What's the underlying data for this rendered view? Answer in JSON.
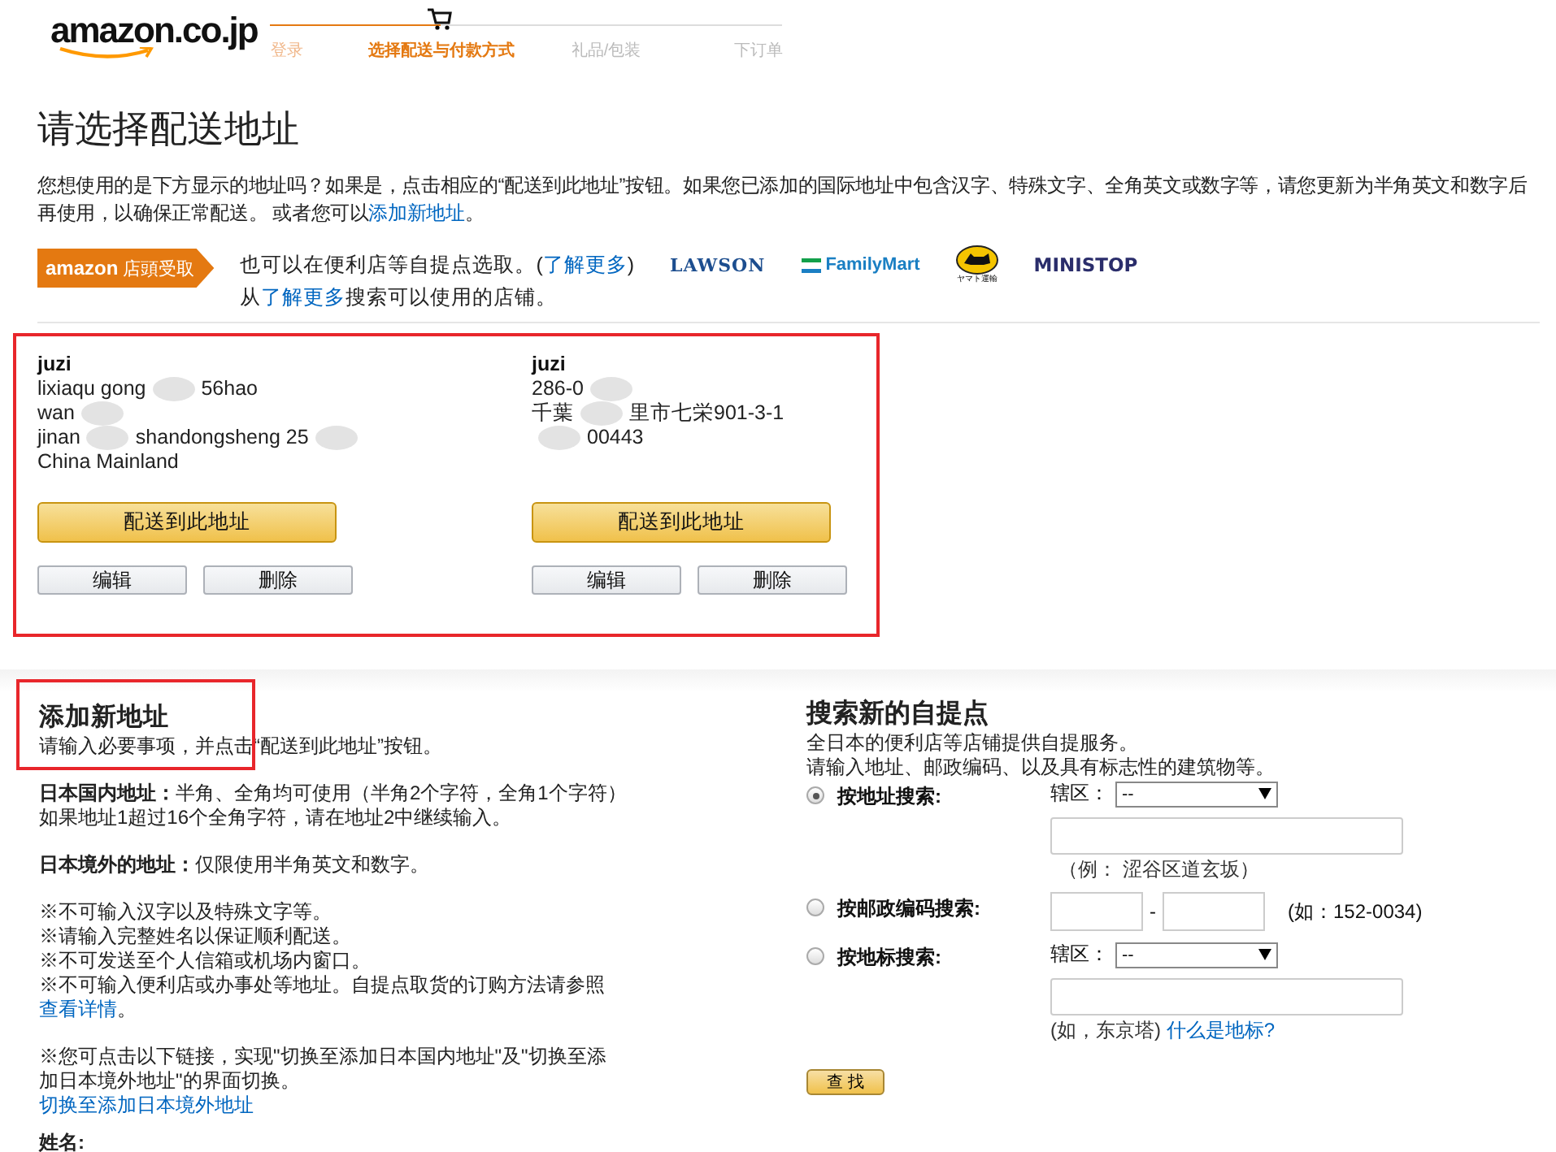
{
  "header": {
    "logo": "amazon.co.jp",
    "steps": [
      {
        "label": "登录",
        "completed": true,
        "selected": false
      },
      {
        "label": "选择配送与付款方式",
        "completed": false,
        "selected": true
      },
      {
        "label": "礼品/包装",
        "completed": false,
        "selected": false
      },
      {
        "label": "下订单",
        "completed": false,
        "selected": false
      }
    ]
  },
  "page_title": "请选择配送地址",
  "intro": {
    "text": "您想使用的是下方显示的地址吗？如果是，点击相应的“配送到此地址”按钮。如果您已添加的国际地址中包含汉字、特殊文字、全角英文或数字等，请您更新为半角英文和数字后再使用，以确保正常配送。 或者您可以",
    "link": "添加新地址",
    "end": "。"
  },
  "pickup": {
    "badge_brand": "amazon",
    "badge_label": "店頭受取",
    "line1": "也可以在便利店等自提点选取。(",
    "line1_link": "了解更多",
    "line1_end": ")",
    "line2_start": "从",
    "line2_link": "了解更多",
    "line2_end": "搜索可以使用的店铺。",
    "brands": [
      {
        "kind": "lawson",
        "name": "LAWSON"
      },
      {
        "kind": "familymart",
        "name": "FamilyMart"
      },
      {
        "kind": "yamato",
        "name": "ヤマト運輸"
      },
      {
        "kind": "ministop",
        "name": "MINISTOP"
      }
    ]
  },
  "addresses": {
    "highlighted": true,
    "cards": [
      {
        "name": "juzi",
        "lines": [
          {
            "blur_start": false,
            "parts": [
              "lixiaqu gong",
              "56hao"
            ],
            "blur_end": false
          },
          {
            "blur_start": false,
            "parts": [
              "wan"
            ],
            "blur_end": true
          },
          {
            "blur_start": false,
            "parts": [
              "jinan",
              "shandongsheng 25"
            ],
            "blur_end": true
          },
          {
            "blur_start": false,
            "parts": [
              "China Mainland"
            ],
            "blur_end": false
          }
        ],
        "ship_button": "配送到此地址",
        "edit_button": "编辑",
        "delete_button": "删除"
      },
      {
        "name": "juzi",
        "lines": [
          {
            "blur_start": false,
            "parts": [
              "286-0"
            ],
            "blur_end": true
          },
          {
            "blur_start": false,
            "parts": [
              "千葉",
              "里市七栄901-3-1"
            ],
            "blur_end": false
          },
          {
            "blur_start": true,
            "parts": [
              "00443"
            ],
            "blur_end": false
          }
        ],
        "ship_button": "配送到此地址",
        "edit_button": "编辑",
        "delete_button": "删除"
      }
    ]
  },
  "add_address": {
    "title": "添加新地址",
    "highlighted": true,
    "subtitle": "请输入必要事项，并点击“配送到此地址”按钮。",
    "domestic_label": "日本国内地址：",
    "domestic_text": "半角、全角均可使用（半角2个字符，全角1个字符）",
    "domestic_note": "如果地址1超过16个全角字符，请在地址2中继续输入。",
    "overseas_label": "日本境外的地址：",
    "overseas_text": "仅限使用半角英文和数字。",
    "notes": [
      "※不可输入汉字以及特殊文字等。",
      "※请输入完整姓名以保证顺利配送。",
      "※不可发送至个人信箱或机场内窗口。"
    ],
    "note_last": "※不可输入便利店或办事处等地址。自提点取货的订购方法请参照",
    "note_last_link": "查看详情",
    "note_last_end": "。",
    "switch_note": "※您可点击以下链接，实现\"切换至添加日本国内地址\"及\"切换至添加日本境外地址\"的界面切换。",
    "switch_link": "切换至添加日本境外地址",
    "name_label": "姓名:"
  },
  "pickup_search": {
    "title": "搜索新的自提点",
    "desc1": "全日本的便利店等店铺提供自提服务。",
    "desc2": "请输入地址、邮政编码、以及具有标志性的建筑物等。",
    "options": [
      {
        "kind": "address",
        "label": "按地址搜索:",
        "selected": true,
        "area_label": "辖区：",
        "area_value": "--",
        "hint": "（例： 涩谷区道玄坂）"
      },
      {
        "kind": "postal",
        "label": "按邮政编码搜索:",
        "selected": false,
        "dash": "-",
        "hint": "(如：152-0034)"
      },
      {
        "kind": "landmark",
        "label": "按地标搜索:",
        "selected": false,
        "area_label": "辖区：",
        "area_value": "--",
        "hint": "(如，东京塔)",
        "hint_link": "什么是地标?"
      }
    ],
    "search_button": "查 找"
  }
}
